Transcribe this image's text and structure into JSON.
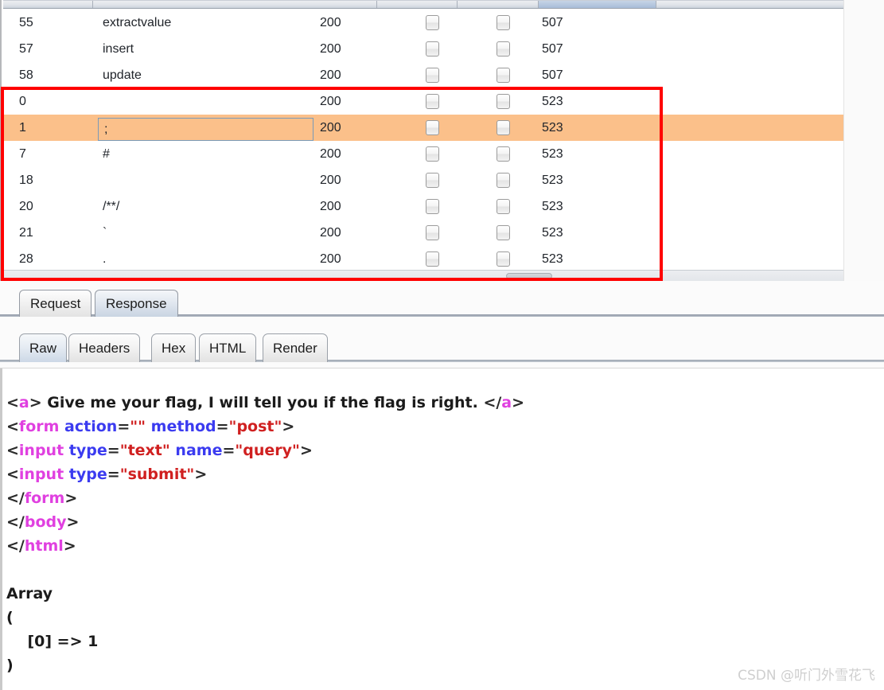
{
  "results_table": {
    "columns": [
      {
        "key": "index",
        "label": ""
      },
      {
        "key": "payload",
        "label": ""
      },
      {
        "key": "status",
        "label": ""
      },
      {
        "key": "error",
        "label": ""
      },
      {
        "key": "timeout",
        "label": ""
      },
      {
        "key": "length",
        "label": "",
        "sorted": true
      }
    ],
    "rows": [
      {
        "index": "55",
        "payload": "extractvalue",
        "status": "200",
        "error": false,
        "timeout": false,
        "length": "507",
        "selected": false,
        "editing": false
      },
      {
        "index": "57",
        "payload": "insert",
        "status": "200",
        "error": false,
        "timeout": false,
        "length": "507",
        "selected": false,
        "editing": false
      },
      {
        "index": "58",
        "payload": "update",
        "status": "200",
        "error": false,
        "timeout": false,
        "length": "507",
        "selected": false,
        "editing": false
      },
      {
        "index": "0",
        "payload": "",
        "status": "200",
        "error": false,
        "timeout": false,
        "length": "523",
        "selected": false,
        "editing": false
      },
      {
        "index": "1",
        "payload": ";",
        "status": "200",
        "error": false,
        "timeout": false,
        "length": "523",
        "selected": true,
        "editing": true
      },
      {
        "index": "7",
        "payload": "#",
        "status": "200",
        "error": false,
        "timeout": false,
        "length": "523",
        "selected": false,
        "editing": false
      },
      {
        "index": "18",
        "payload": "",
        "status": "200",
        "error": false,
        "timeout": false,
        "length": "523",
        "selected": false,
        "editing": false
      },
      {
        "index": "20",
        "payload": "/**/",
        "status": "200",
        "error": false,
        "timeout": false,
        "length": "523",
        "selected": false,
        "editing": false
      },
      {
        "index": "21",
        "payload": "`",
        "status": "200",
        "error": false,
        "timeout": false,
        "length": "523",
        "selected": false,
        "editing": false
      },
      {
        "index": "28",
        "payload": ".",
        "status": "200",
        "error": false,
        "timeout": false,
        "length": "523",
        "selected": false,
        "editing": false
      }
    ],
    "editor_value": ";"
  },
  "annotation": {
    "highlight_color": "#ff0000"
  },
  "message_tabs": {
    "items": [
      {
        "label": "Request",
        "active": false
      },
      {
        "label": "Response",
        "active": true
      }
    ]
  },
  "view_tabs": {
    "items": [
      {
        "label": "Raw",
        "active": true
      },
      {
        "label": "Headers",
        "active": false
      },
      {
        "label": "Hex",
        "active": false
      },
      {
        "label": "HTML",
        "active": false
      },
      {
        "label": "Render",
        "active": false
      }
    ]
  },
  "response": {
    "lines": [
      {
        "tokens": [
          {
            "t": "br",
            "v": "<"
          },
          {
            "t": "tg",
            "v": "a"
          },
          {
            "t": "br",
            "v": ">"
          },
          {
            "t": "txt",
            "v": " Give me your flag, I will tell you if the flag is right. "
          },
          {
            "t": "br",
            "v": "</"
          },
          {
            "t": "tg",
            "v": "a"
          },
          {
            "t": "br",
            "v": ">"
          }
        ]
      },
      {
        "tokens": [
          {
            "t": "br",
            "v": "<"
          },
          {
            "t": "tg",
            "v": "form"
          },
          {
            "t": "txt",
            "v": " "
          },
          {
            "t": "at",
            "v": "action"
          },
          {
            "t": "br",
            "v": "="
          },
          {
            "t": "vl",
            "v": "\"\""
          },
          {
            "t": "txt",
            "v": " "
          },
          {
            "t": "at",
            "v": "method"
          },
          {
            "t": "br",
            "v": "="
          },
          {
            "t": "vl",
            "v": "\"post\""
          },
          {
            "t": "br",
            "v": ">"
          }
        ]
      },
      {
        "tokens": [
          {
            "t": "br",
            "v": "<"
          },
          {
            "t": "tg",
            "v": "input"
          },
          {
            "t": "txt",
            "v": " "
          },
          {
            "t": "at",
            "v": "type"
          },
          {
            "t": "br",
            "v": "="
          },
          {
            "t": "vl",
            "v": "\"text\""
          },
          {
            "t": "txt",
            "v": " "
          },
          {
            "t": "at",
            "v": "name"
          },
          {
            "t": "br",
            "v": "="
          },
          {
            "t": "vl",
            "v": "\"query\""
          },
          {
            "t": "br",
            "v": ">"
          }
        ]
      },
      {
        "tokens": [
          {
            "t": "br",
            "v": "<"
          },
          {
            "t": "tg",
            "v": "input"
          },
          {
            "t": "txt",
            "v": " "
          },
          {
            "t": "at",
            "v": "type"
          },
          {
            "t": "br",
            "v": "="
          },
          {
            "t": "vl",
            "v": "\"submit\""
          },
          {
            "t": "br",
            "v": ">"
          }
        ]
      },
      {
        "tokens": [
          {
            "t": "br",
            "v": "</"
          },
          {
            "t": "tg",
            "v": "form"
          },
          {
            "t": "br",
            "v": ">"
          }
        ]
      },
      {
        "tokens": [
          {
            "t": "br",
            "v": "</"
          },
          {
            "t": "tg",
            "v": "body"
          },
          {
            "t": "br",
            "v": ">"
          }
        ]
      },
      {
        "tokens": [
          {
            "t": "br",
            "v": "</"
          },
          {
            "t": "tg",
            "v": "html"
          },
          {
            "t": "br",
            "v": ">"
          }
        ]
      },
      {
        "tokens": []
      },
      {
        "tokens": [
          {
            "t": "plain",
            "v": "Array"
          }
        ]
      },
      {
        "tokens": [
          {
            "t": "plain",
            "v": "("
          }
        ]
      },
      {
        "tokens": [
          {
            "t": "plain",
            "v": "    [0] => 1"
          }
        ]
      },
      {
        "tokens": [
          {
            "t": "plain",
            "v": ")"
          }
        ]
      }
    ]
  },
  "watermark": {
    "text": "CSDN @听门外雪花飞"
  }
}
